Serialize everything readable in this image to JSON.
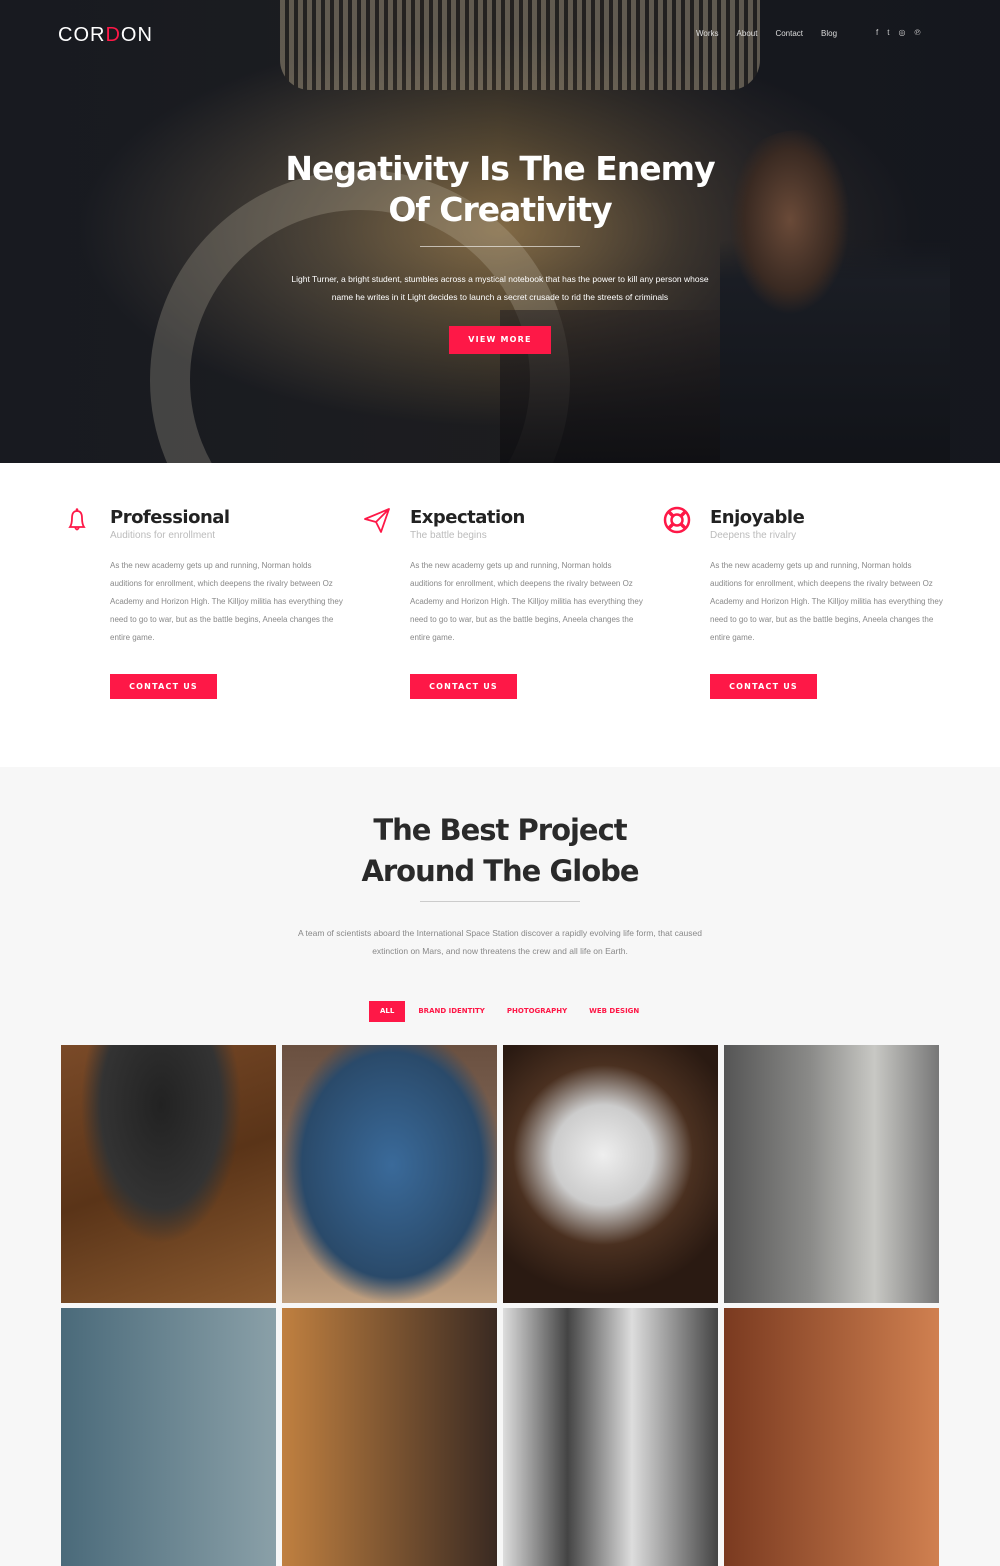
{
  "header": {
    "logo": "CORDON",
    "nav": [
      "Works",
      "About",
      "Contact",
      "Blog"
    ],
    "social": [
      "facebook-icon",
      "twitter-icon",
      "instagram-icon",
      "pinterest-icon"
    ]
  },
  "hero": {
    "title_line1": "Negativity Is The Enemy",
    "title_line2": "Of Creativity",
    "text": "Light Turner, a bright student, stumbles across a mystical notebook that has the power to kill any person whose name he writes in it Light decides to launch a secret crusade to rid the streets of criminals",
    "button": "VIEW MORE"
  },
  "features": [
    {
      "icon": "bell-icon",
      "title": "Professional",
      "subtitle": "Auditions for enrollment",
      "body": "As the new academy gets up and running, Norman holds auditions for enrollment, which deepens the rivalry between Oz Academy and Horizon High. The Killjoy militia has everything they need to go to war, but as the battle begins, Aneela changes the entire game.",
      "button": "CONTACT US"
    },
    {
      "icon": "paper-plane-icon",
      "title": "Expectation",
      "subtitle": "The battle begins",
      "body": "As the new academy gets up and running, Norman holds auditions for enrollment, which deepens the rivalry between Oz Academy and Horizon High. The Killjoy militia has everything they need to go to war, but as the battle begins, Aneela changes the entire game.",
      "button": "CONTACT US"
    },
    {
      "icon": "lifebuoy-icon",
      "title": "Enjoyable",
      "subtitle": "Deepens the rivalry",
      "body": "As the new academy gets up and running, Norman holds auditions for enrollment, which deepens the rivalry between Oz Academy and Horizon High. The Killjoy militia has everything they need to go to war, but as the battle begins, Aneela changes the entire game.",
      "button": "CONTACT US"
    }
  ],
  "projects": {
    "title_line1": "The Best Project",
    "title_line2": "Around The Globe",
    "text": "A team of scientists aboard the International Space Station discover a rapidly evolving life form, that caused extinction on Mars, and now threatens the crew and all life on Earth.",
    "filters": [
      "ALL",
      "BRAND IDENTITY",
      "PHOTOGRAPHY",
      "WEB DESIGN"
    ],
    "active_filter": "ALL"
  },
  "colors": {
    "accent": "#fe1847",
    "dark": "#222222",
    "muted": "#888888"
  }
}
